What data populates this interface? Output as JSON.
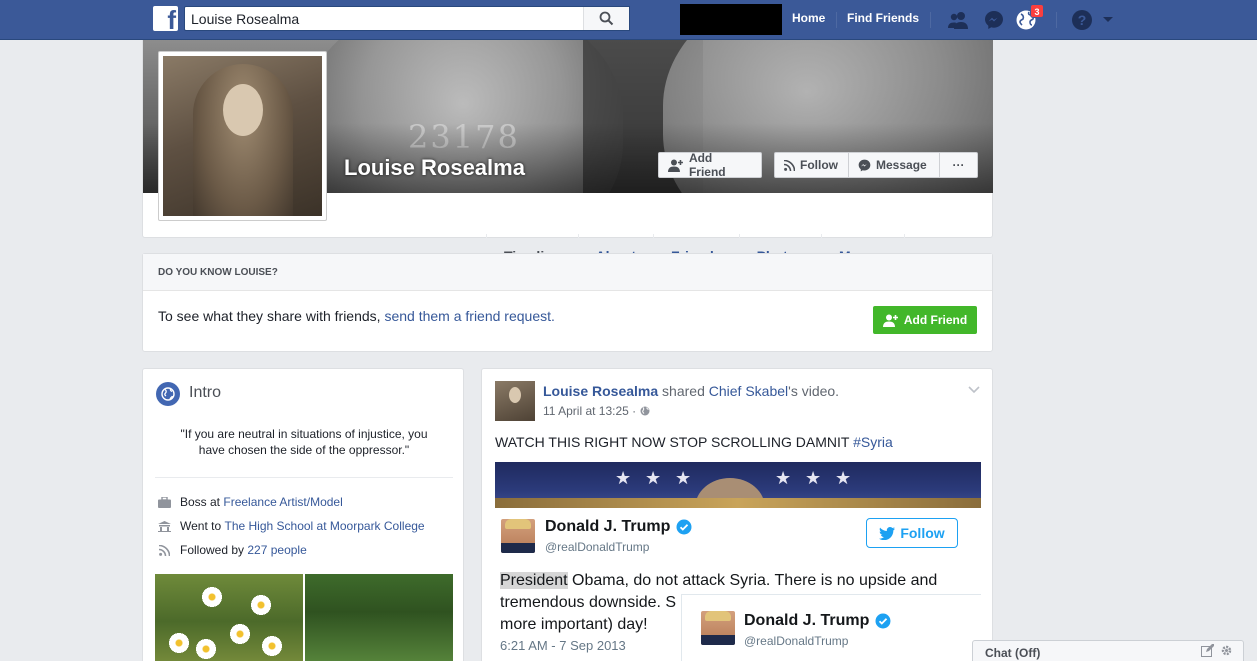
{
  "header": {
    "logo_letter": "f",
    "search_value": "Louise Rosealma",
    "nav": {
      "home": "Home",
      "find_friends": "Find Friends"
    },
    "notifications_count": "3"
  },
  "profile": {
    "name": "Louise Rosealma",
    "cover_number": "23178",
    "buttons": {
      "add_friend": "Add Friend",
      "follow": "Follow",
      "message": "Message",
      "more": "···"
    },
    "tabs": [
      "Timeline",
      "About",
      "Friends",
      "Photos",
      "More"
    ]
  },
  "know_box": {
    "heading": "DO YOU KNOW LOUISE?",
    "text_prefix": "To see what they share with friends, ",
    "text_link": "send them a friend request.",
    "button": "Add Friend"
  },
  "intro": {
    "title": "Intro",
    "quote": "\"If you are neutral in situations of injustice, you have chosen the side of the oppressor.\"",
    "work_prefix": "Boss at ",
    "work_link": "Freelance Artist/Model",
    "school_prefix": "Went to ",
    "school_link": "The High School at Moorpark College",
    "followed_prefix": "Followed by ",
    "followed_link": "227 people"
  },
  "post": {
    "author": "Louise Rosealma",
    "action": " shared ",
    "source": "Chief Skabel",
    "source_suffix": "'s video.",
    "time": "11 April at 13:25 · ",
    "text": "WATCH THIS RIGHT NOW STOP SCROLLING DAMNIT ",
    "hashtag": "#Syria",
    "tweet": {
      "name": "Donald J. Trump",
      "handle": "@realDonaldTrump",
      "follow": "Follow",
      "highlight": "President",
      "body_line1": " Obama, do not attack Syria. There is no upside and",
      "body_line2": "tremendous downside. S",
      "body_line3": "more important) day!",
      "date": "6:21 AM - 7 Sep 2013"
    }
  },
  "chat": {
    "label": "Chat (Off)"
  },
  "colors": {
    "brand": "#3b5998",
    "link": "#365899",
    "green": "#42b72a",
    "twitter": "#1da1f2"
  }
}
